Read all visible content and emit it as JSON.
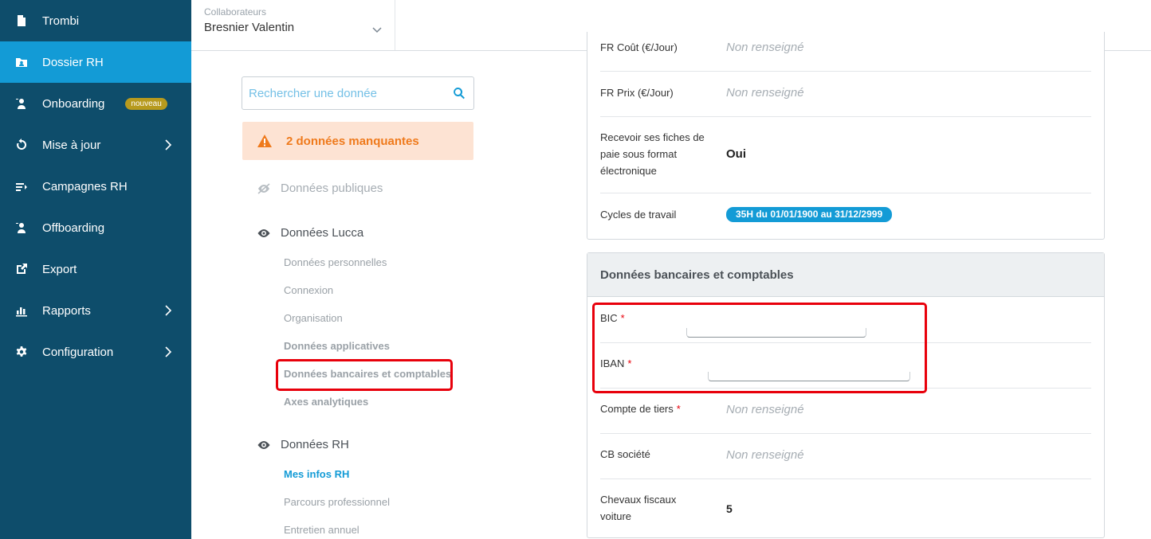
{
  "sidebar": {
    "items": [
      {
        "label": "Trombi",
        "icon": "document-icon"
      },
      {
        "label": "Dossier RH",
        "icon": "folder-user-icon",
        "active": true
      },
      {
        "label": "Onboarding",
        "icon": "person-plus-icon",
        "badge": "nouveau"
      },
      {
        "label": "Mise à jour",
        "icon": "refresh-icon",
        "has_submenu": true
      },
      {
        "label": "Campagnes RH",
        "icon": "campaign-icon"
      },
      {
        "label": "Offboarding",
        "icon": "person-minus-icon"
      },
      {
        "label": "Export",
        "icon": "export-icon"
      },
      {
        "label": "Rapports",
        "icon": "bar-chart-icon",
        "has_submenu": true
      },
      {
        "label": "Configuration",
        "icon": "gear-icon",
        "has_submenu": true
      }
    ]
  },
  "header": {
    "collab_label": "Collaborateurs",
    "collab_value": "Bresnier Valentin"
  },
  "left": {
    "search_placeholder": "Rechercher une donnée",
    "missing_banner": "2 données manquantes",
    "sections": {
      "public": "Données publiques",
      "lucca": "Données Lucca",
      "rh": "Données RH"
    },
    "lucca_links": [
      "Données personnelles",
      "Connexion",
      "Organisation",
      "Données applicatives",
      "Données bancaires et comptables",
      "Axes analytiques"
    ],
    "rh_links": [
      "Mes infos RH",
      "Parcours professionnel",
      "Entretien annuel"
    ]
  },
  "panel1": {
    "rows": [
      {
        "label": "FR Coût (€/Jour)",
        "value": "Non renseigné"
      },
      {
        "label": "FR Prix (€/Jour)",
        "value": "Non renseigné"
      },
      {
        "label": "Recevoir ses fiches de paie sous format électronique",
        "value": "Oui"
      },
      {
        "label": "Cycles de travail",
        "value": "35H du 01/01/1900 au 31/12/2999"
      }
    ]
  },
  "panel2": {
    "title": "Données bancaires et comptables",
    "rows": [
      {
        "label": "BIC",
        "required": "*",
        "value": ""
      },
      {
        "label": "IBAN",
        "required": "*",
        "value": ""
      },
      {
        "label": "Compte de tiers",
        "required": "*",
        "value": "Non renseigné"
      },
      {
        "label": "CB société",
        "value": "Non renseigné"
      },
      {
        "label": "Chevaux fiscaux voiture",
        "value": "5"
      }
    ]
  },
  "colors": {
    "sidebar_bg": "#0e4d6b",
    "accent": "#139bd6",
    "warning": "#ef7a1c",
    "highlight": "#e8000b"
  }
}
